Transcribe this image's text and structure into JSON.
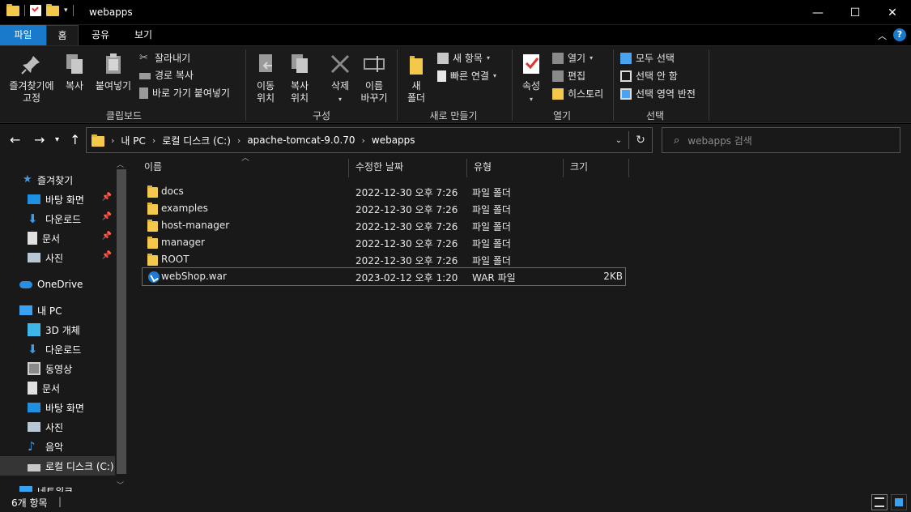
{
  "window": {
    "title": "webapps",
    "controls": {
      "minimize": "—",
      "maximize": "☐",
      "close": "✕"
    }
  },
  "ribbon_tabs": [
    "파일",
    "홈",
    "공유",
    "보기"
  ],
  "help_label": "?",
  "ribbon": {
    "clipboard": {
      "pin_label": "즐겨찾기에\n고정",
      "copy_label": "복사",
      "paste_label": "붙여넣기",
      "cut_label": "잘라내기",
      "copy_path_label": "경로 복사",
      "paste_shortcut_label": "바로 가기 붙여넣기",
      "group_label": "클립보드"
    },
    "organize": {
      "move_label": "이동\n위치",
      "copy_to_label": "복사\n위치",
      "delete_label": "삭제",
      "rename_label": "이름\n바꾸기",
      "group_label": "구성"
    },
    "new": {
      "new_folder_label": "새\n폴더",
      "new_item_label": "새 항목",
      "easy_access_label": "빠른 연결",
      "group_label": "새로 만들기"
    },
    "open": {
      "properties_label": "속성",
      "open_label": "열기",
      "edit_label": "편집",
      "history_label": "히스토리",
      "group_label": "열기"
    },
    "select": {
      "select_all_label": "모두 선택",
      "select_none_label": "선택 안 함",
      "invert_label": "선택 영역 반전",
      "group_label": "선택"
    }
  },
  "address": {
    "crumbs": [
      "내 PC",
      "로컬 디스크 (C:)",
      "apache-tomcat-9.0.70",
      "webapps"
    ]
  },
  "search": {
    "placeholder": "webapps 검색"
  },
  "nav": {
    "quick_access": "즐겨찾기",
    "quick_items": [
      "바탕 화면",
      "다운로드",
      "문서",
      "사진"
    ],
    "onedrive": "OneDrive",
    "this_pc": "내 PC",
    "pc_items": [
      "3D 개체",
      "다운로드",
      "동영상",
      "문서",
      "바탕 화면",
      "사진",
      "음악",
      "로컬 디스크 (C:)"
    ],
    "network": "네트워크"
  },
  "columns": {
    "name": "이름",
    "modified": "수정한 날짜",
    "type": "유형",
    "size": "크기"
  },
  "files": [
    {
      "name": "docs",
      "modified": "2022-12-30 오후 7:26",
      "type": "파일 폴더",
      "size": ""
    },
    {
      "name": "examples",
      "modified": "2022-12-30 오후 7:26",
      "type": "파일 폴더",
      "size": ""
    },
    {
      "name": "host-manager",
      "modified": "2022-12-30 오후 7:26",
      "type": "파일 폴더",
      "size": ""
    },
    {
      "name": "manager",
      "modified": "2022-12-30 오후 7:26",
      "type": "파일 폴더",
      "size": ""
    },
    {
      "name": "ROOT",
      "modified": "2022-12-30 오후 7:26",
      "type": "파일 폴더",
      "size": ""
    },
    {
      "name": "webShop.war",
      "modified": "2023-02-12 오후 1:20",
      "type": "WAR 파일",
      "size": "2KB"
    }
  ],
  "status": {
    "count": "6개 항목",
    "sep": "|"
  }
}
